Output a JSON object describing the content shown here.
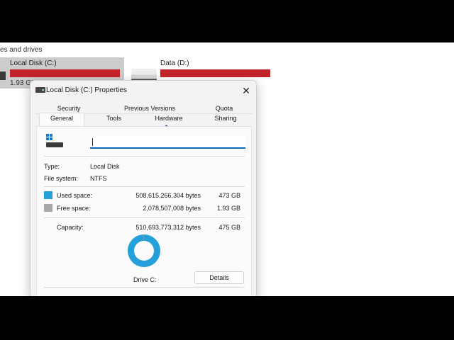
{
  "explorer": {
    "section_title": "es and drives",
    "drives": [
      {
        "name": "Local Disk (C:)",
        "free_text": "1.93 GB",
        "used_fraction": 0.996
      },
      {
        "name": "Data (D:)",
        "free_text": "",
        "used_fraction": 1.0
      }
    ],
    "bar_color": "#c4232b"
  },
  "dialog": {
    "title": "Local Disk (C:) Properties",
    "close_glyph": "✕",
    "tabs_row1": [
      "Security",
      "Previous Versions",
      "Quota"
    ],
    "tabs_row2": [
      "General",
      "Tools",
      "Hardware",
      "Sharing"
    ],
    "active_tab": "General",
    "name_value": "",
    "type_label": "Type:",
    "type_value": "Local Disk",
    "fs_label": "File system:",
    "fs_value": "NTFS",
    "used_label": "Used space:",
    "used_bytes": "508,615,266,304 bytes",
    "used_gb": "473 GB",
    "free_label": "Free space:",
    "free_bytes": "2,078,507,008 bytes",
    "free_gb": "1.93 GB",
    "capacity_label": "Capacity:",
    "capacity_bytes": "510,693,773,312 bytes",
    "capacity_gb": "475 GB",
    "drive_label": "Drive C:",
    "details_label": "Details",
    "used_color": "#26a0da",
    "free_color": "#a8a8a8",
    "used_fraction": 0.996
  }
}
